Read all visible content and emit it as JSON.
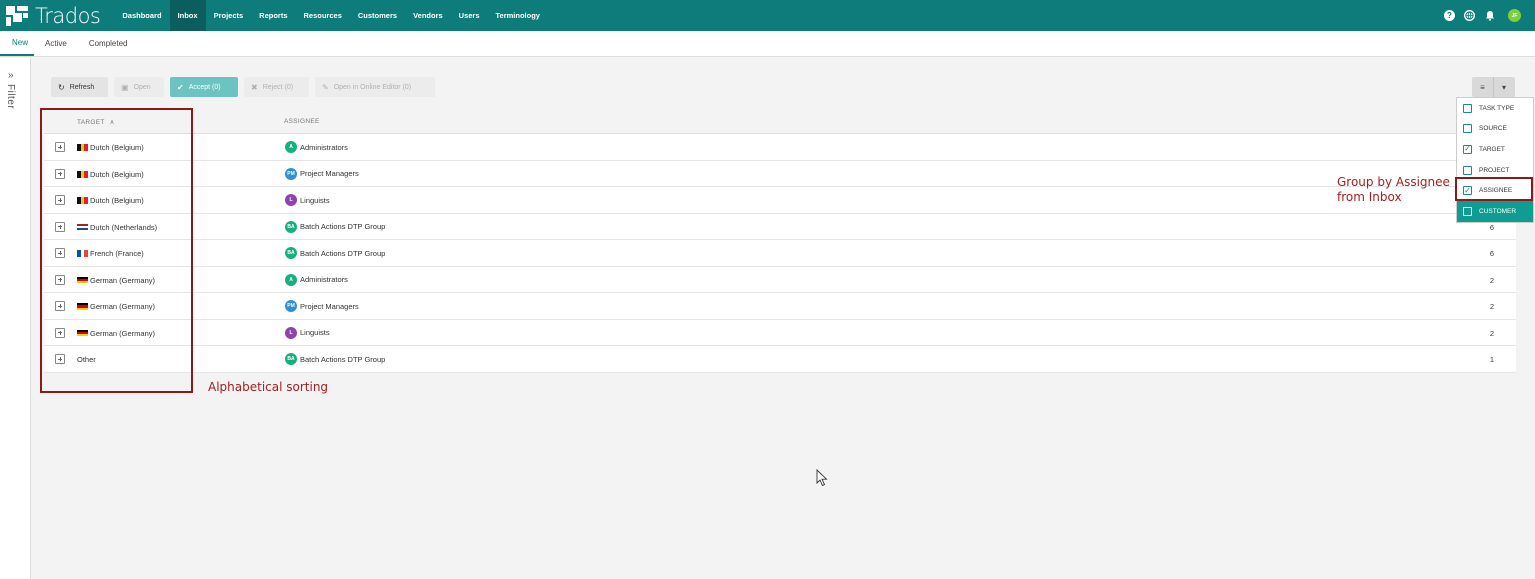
{
  "app": {
    "name": "Trados"
  },
  "nav": {
    "items": [
      {
        "label": "Dashboard"
      },
      {
        "label": "Inbox",
        "active": true
      },
      {
        "label": "Projects"
      },
      {
        "label": "Reports"
      },
      {
        "label": "Resources"
      },
      {
        "label": "Customers"
      },
      {
        "label": "Vendors"
      },
      {
        "label": "Users"
      },
      {
        "label": "Terminology"
      }
    ]
  },
  "topbar": {
    "icons": [
      "help-icon",
      "globe-icon",
      "bell-icon"
    ],
    "user_initials": "JF"
  },
  "subtabs": [
    {
      "label": "New",
      "active": true
    },
    {
      "label": "Active"
    },
    {
      "label": "Completed"
    }
  ],
  "filter": {
    "label": "Filter"
  },
  "toolbar": {
    "refresh": "Refresh",
    "open": "Open",
    "accept": "Accept (0)",
    "reject": "Reject (0)",
    "open_online": "Open in Online Editor (0)"
  },
  "table": {
    "columns": {
      "target": "TARGET",
      "assignee": "ASSIGNEE"
    },
    "rows": [
      {
        "target": "Dutch (Belgium)",
        "flag": "be",
        "assignee": "Administrators",
        "initials": "A",
        "color": "#17b07c",
        "count": ""
      },
      {
        "target": "Dutch (Belgium)",
        "flag": "be",
        "assignee": "Project Managers",
        "initials": "PM",
        "color": "#2f8fd8",
        "count": ""
      },
      {
        "target": "Dutch (Belgium)",
        "flag": "be",
        "assignee": "Linguists",
        "initials": "L",
        "color": "#8e44ad",
        "count": ""
      },
      {
        "target": "Dutch (Netherlands)",
        "flag": "nl",
        "assignee": "Batch Actions DTP Group",
        "initials": "BA",
        "color": "#17b07c",
        "count": "6"
      },
      {
        "target": "French (France)",
        "flag": "fr",
        "assignee": "Batch Actions DTP Group",
        "initials": "BA",
        "color": "#17b07c",
        "count": "6"
      },
      {
        "target": "German (Germany)",
        "flag": "de",
        "assignee": "Administrators",
        "initials": "A",
        "color": "#17b07c",
        "count": "2"
      },
      {
        "target": "German (Germany)",
        "flag": "de",
        "assignee": "Project Managers",
        "initials": "PM",
        "color": "#2f8fd8",
        "count": "2"
      },
      {
        "target": "German (Germany)",
        "flag": "de",
        "assignee": "Linguists",
        "initials": "L",
        "color": "#8e44ad",
        "count": "2"
      },
      {
        "target": "Other",
        "flag": "",
        "assignee": "Batch Actions DTP Group",
        "initials": "BA",
        "color": "#17b07c",
        "count": "1"
      }
    ]
  },
  "column_menu": [
    {
      "label": "TASK TYPE",
      "checked": false
    },
    {
      "label": "SOURCE",
      "checked": false
    },
    {
      "label": "TARGET",
      "checked": true
    },
    {
      "label": "PROJECT",
      "checked": false
    },
    {
      "label": "ASSIGNEE",
      "checked": true
    },
    {
      "label": "CUSTOMER",
      "checked": false,
      "highlighted": true
    }
  ],
  "annotations": {
    "alphabetical": "Alphabetical sorting",
    "group_line1": "Group by Assignee",
    "group_line2": "from Inbox"
  },
  "colors": {
    "brand": "#0e7c7b",
    "annotation": "#8b1a1a"
  }
}
